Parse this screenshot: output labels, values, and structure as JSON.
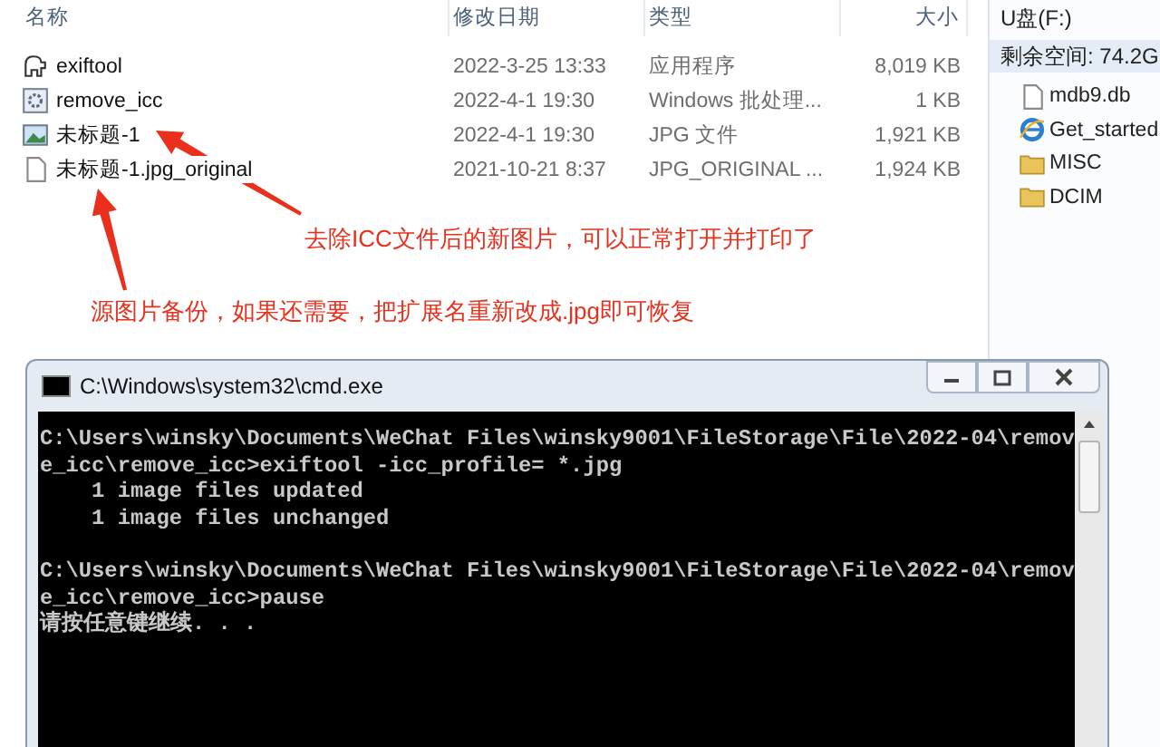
{
  "file_list": {
    "columns": [
      "名称",
      "修改日期",
      "类型",
      "大小"
    ],
    "files": [
      {
        "kind": "animal",
        "name": "exiftool",
        "date": "2022-3-25 13:33",
        "type": "应用程序",
        "size": "8,019 KB"
      },
      {
        "kind": "gear",
        "name": "remove_icc",
        "date": "2022-4-1 19:30",
        "type": "Windows 批处理...",
        "size": "1 KB"
      },
      {
        "kind": "image",
        "name": "未标题-1",
        "date": "2022-4-1 19:30",
        "type": "JPG 文件",
        "size": "1,921 KB"
      },
      {
        "kind": "document",
        "name": "未标题-1.jpg_original",
        "date": "2021-10-21 8:37",
        "type": "JPG_ORIGINAL ...",
        "size": "1,924 KB"
      }
    ]
  },
  "drive_pane": {
    "title": "U盘(F:)",
    "free_space": "剩余空间: 74.2G",
    "items": [
      {
        "kind": "document",
        "name": "mdb9.db"
      },
      {
        "kind": "browser",
        "name": "Get_started"
      },
      {
        "kind": "folder",
        "name": "MISC"
      },
      {
        "kind": "folder",
        "name": "DCIM"
      }
    ]
  },
  "annotations": [
    "去除ICC文件后的新图片，可以正常打开并打印了",
    "源图片备份，如果还需要，把扩展名重新改成.jpg即可恢复"
  ],
  "cmd_window": {
    "title": "C:\\Windows\\system32\\cmd.exe",
    "blocks": [
      [
        "C:\\Users\\winsky\\Documents\\WeChat Files\\winsky9001\\FileStorage\\File\\2022-04\\remov",
        "e_icc\\remove_icc>exiftool -icc_profile= *.jpg",
        "    1 image files updated",
        "    1 image files unchanged"
      ],
      [
        "C:\\Users\\winsky\\Documents\\WeChat Files\\winsky9001\\FileStorage\\File\\2022-04\\remov",
        "e_icc\\remove_icc>pause",
        "请按任意键继续. . ."
      ]
    ]
  }
}
